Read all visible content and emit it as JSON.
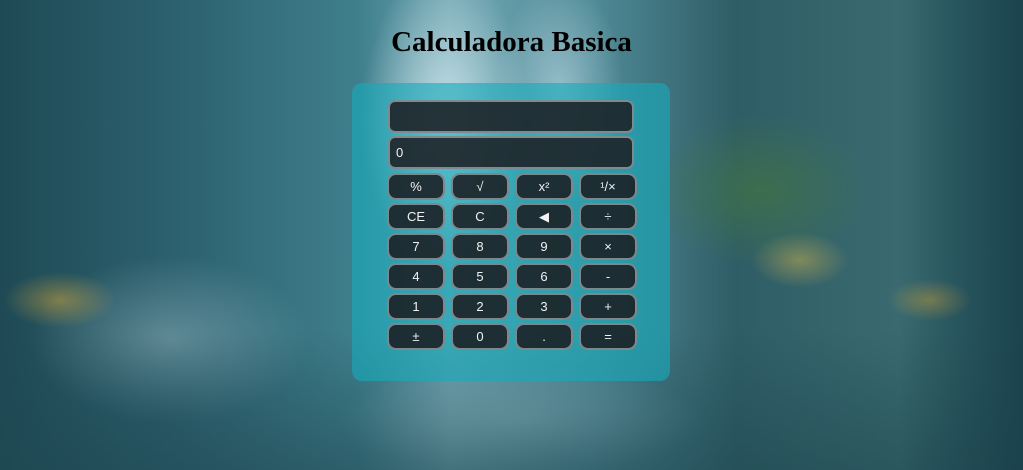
{
  "title": "Calculadora Basica",
  "display": {
    "expression": "",
    "result": "0"
  },
  "keys": {
    "percent": "%",
    "sqrt": "√",
    "square": "x²",
    "reciprocal": "¹/×",
    "clear_entry": "CE",
    "clear": "C",
    "backspace": "◀",
    "divide": "÷",
    "seven": "7",
    "eight": "8",
    "nine": "9",
    "multiply": "×",
    "four": "4",
    "five": "5",
    "six": "6",
    "subtract": "-",
    "one": "1",
    "two": "2",
    "three": "3",
    "add": "+",
    "negate": "±",
    "zero": "0",
    "decimal": ".",
    "equals": "="
  },
  "colors": {
    "panel": "#19aab9",
    "key_background": "#1a1e22",
    "key_border": "#7c888c",
    "key_text": "#f2f2f2"
  }
}
